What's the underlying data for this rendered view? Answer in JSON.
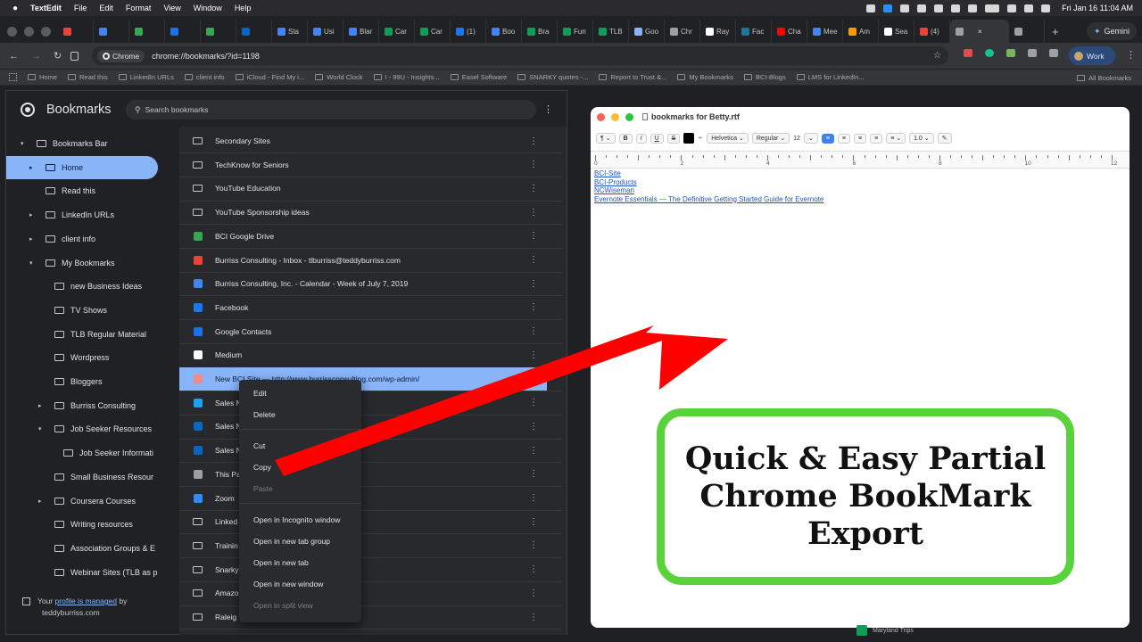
{
  "menubar": {
    "app": "TextEdit",
    "items": [
      "File",
      "Edit",
      "Format",
      "View",
      "Window",
      "Help"
    ],
    "clock": "Fri Jan 16  11:04 AM"
  },
  "tabs": [
    {
      "label": "",
      "color": "#ea4335"
    },
    {
      "label": "",
      "color": "#4285f4"
    },
    {
      "label": "",
      "color": "#34a853"
    },
    {
      "label": "",
      "color": "#1a73e8"
    },
    {
      "label": "",
      "color": "#34a853"
    },
    {
      "label": "",
      "color": "#0a66c2"
    },
    {
      "label": "Sta",
      "color": "#4285f4"
    },
    {
      "label": "Usi",
      "color": "#4285f4"
    },
    {
      "label": "Blar",
      "color": "#4285f4"
    },
    {
      "label": "Car",
      "color": "#0f9d58"
    },
    {
      "label": "Car",
      "color": "#0f9d58"
    },
    {
      "label": "(1)",
      "color": "#1877f2"
    },
    {
      "label": "Boo",
      "color": "#4285f4"
    },
    {
      "label": "Bra",
      "color": "#0f9d58"
    },
    {
      "label": "Fun",
      "color": "#0f9d58"
    },
    {
      "label": "TLB",
      "color": "#0f9d58"
    },
    {
      "label": "Goo",
      "color": "#8ab4f8"
    },
    {
      "label": "Chr",
      "color": "#9aa0a6"
    },
    {
      "label": "Ray",
      "color": "#ffffff"
    },
    {
      "label": "Fac",
      "color": "#21759b"
    },
    {
      "label": "Cha",
      "color": "#ff0000"
    },
    {
      "label": "Mee",
      "color": "#4285f4"
    },
    {
      "label": "Am",
      "color": "#ff9900"
    },
    {
      "label": "Sea",
      "color": "#ffffff"
    },
    {
      "label": "(4)",
      "color": "#ea4335"
    },
    {
      "label": "",
      "color": "#9aa0a6"
    },
    {
      "label": "",
      "color": "#9aa0a6"
    }
  ],
  "gemini_label": "Gemini",
  "omnibox": {
    "chip": "Chrome",
    "url": "chrome://bookmarks/?id=1198"
  },
  "work_label": "Work",
  "bookmarks_bar": [
    "Home",
    "Read this",
    "LinkedIn URLs",
    "client info",
    "iCloud - Find My i...",
    "World Clock",
    "! - 99U - Insights...",
    "Easel Software",
    "SNARKY quotes -...",
    "Report to Trust &...",
    "My Bookmarks",
    "BCI-Blogs",
    "LMS for LinkedIn..."
  ],
  "all_bookmarks": "All Bookmarks",
  "bm": {
    "title": "Bookmarks",
    "search_placeholder": "Search bookmarks",
    "tree": [
      {
        "label": "Bookmarks Bar",
        "depth": 0,
        "caret": "open"
      },
      {
        "label": "Home",
        "depth": 1,
        "caret": "closed",
        "selected": true
      },
      {
        "label": "Read this",
        "depth": 1,
        "caret": ""
      },
      {
        "label": "LinkedIn URLs",
        "depth": 1,
        "caret": "closed"
      },
      {
        "label": "client info",
        "depth": 1,
        "caret": "closed"
      },
      {
        "label": "My Bookmarks",
        "depth": 1,
        "caret": "open"
      },
      {
        "label": "new Business Ideas",
        "depth": 2,
        "caret": ""
      },
      {
        "label": "TV Shows",
        "depth": 2,
        "caret": ""
      },
      {
        "label": "TLB Regular Material",
        "depth": 2,
        "caret": ""
      },
      {
        "label": "Wordpress",
        "depth": 2,
        "caret": ""
      },
      {
        "label": "Bloggers",
        "depth": 2,
        "caret": ""
      },
      {
        "label": "Burriss Consulting",
        "depth": 2,
        "caret": "closed"
      },
      {
        "label": "Job Seeker Resources",
        "depth": 2,
        "caret": "open"
      },
      {
        "label": "Job Seeker Informati",
        "depth": 3,
        "caret": ""
      },
      {
        "label": "Small Business Resour",
        "depth": 2,
        "caret": ""
      },
      {
        "label": "Coursera Courses",
        "depth": 2,
        "caret": "closed"
      },
      {
        "label": "Writing resources",
        "depth": 2,
        "caret": ""
      },
      {
        "label": "Association Groups & E",
        "depth": 2,
        "caret": ""
      },
      {
        "label": "Webinar Sites (TLB as p",
        "depth": 2,
        "caret": ""
      }
    ],
    "managed_prefix": "Your ",
    "managed_link": "profile is managed",
    "managed_suffix": " by",
    "managed_domain": "teddyburriss.com",
    "list": [
      {
        "label": "Secondary Sites",
        "kind": "folder"
      },
      {
        "label": "TechKnow for Seniors",
        "kind": "folder"
      },
      {
        "label": "YouTube Education",
        "kind": "folder"
      },
      {
        "label": "YouTube Sponsorship ideas",
        "kind": "folder"
      },
      {
        "label": "BCI Google Drive",
        "kind": "site",
        "color": "#34a853"
      },
      {
        "label": "Burriss Consulting - Inbox - tlburriss@teddyburriss.com",
        "kind": "site",
        "color": "#ea4335"
      },
      {
        "label": "Burriss Consulting, Inc. - Calendar - Week of July 7, 2019",
        "kind": "site",
        "color": "#4285f4"
      },
      {
        "label": "Facebook",
        "kind": "site",
        "color": "#1877f2"
      },
      {
        "label": "Google Contacts",
        "kind": "site",
        "color": "#1a73e8"
      },
      {
        "label": "Medium",
        "kind": "site",
        "color": "#ffffff"
      },
      {
        "label": "New BCI Site — http://www.burrissconsulting.com/wp-admin/",
        "kind": "site",
        "color": "#f28b82",
        "selected": true
      },
      {
        "label": "Sales N",
        "kind": "site",
        "color": "#1da1f2"
      },
      {
        "label": "Sales N",
        "kind": "site",
        "color": "#0a66c2"
      },
      {
        "label": "Sales N",
        "kind": "site",
        "color": "#0a66c2"
      },
      {
        "label": "This Pa",
        "kind": "site",
        "color": "#9aa0a6"
      },
      {
        "label": "Zoom",
        "kind": "site",
        "color": "#2d8cff"
      },
      {
        "label": "Linked",
        "kind": "folder"
      },
      {
        "label": "Trainin",
        "kind": "folder"
      },
      {
        "label": "Snarky",
        "kind": "folder"
      },
      {
        "label": "Amazo",
        "kind": "folder"
      },
      {
        "label": "Raleig",
        "kind": "folder"
      }
    ],
    "context_menu": [
      {
        "label": "Edit",
        "disabled": false,
        "sep_after": false
      },
      {
        "label": "Delete",
        "disabled": false,
        "sep_after": true
      },
      {
        "label": "Cut",
        "disabled": false,
        "sep_after": false
      },
      {
        "label": "Copy",
        "disabled": false,
        "sep_after": false
      },
      {
        "label": "Paste",
        "disabled": true,
        "sep_after": true
      },
      {
        "label": "Open in Incognito window",
        "disabled": false,
        "sep_after": false
      },
      {
        "label": "Open in new tab group",
        "disabled": false,
        "sep_after": false
      },
      {
        "label": "Open in new tab",
        "disabled": false,
        "sep_after": false
      },
      {
        "label": "Open in new window",
        "disabled": false,
        "sep_after": false
      },
      {
        "label": "Open in split view",
        "disabled": true,
        "sep_after": false
      }
    ]
  },
  "rtf": {
    "title": "bookmarks for Betty.rtf",
    "toolbar": {
      "paragraph": "¶",
      "bold": "B",
      "italic": "I",
      "underline": "U",
      "strike": "S",
      "font": "Helvetica",
      "style": "Regular",
      "size": "12",
      "spacing": "1.0"
    },
    "ruler": [
      "0",
      "2",
      "4",
      "6",
      "8",
      "10",
      "12"
    ],
    "links": [
      "BCI-Site",
      "BCI-Products",
      "NCWiseman",
      "Evernote Essentials — The Definitive Getting Started Guide for Evernote"
    ]
  },
  "callout": {
    "text": "Quick & Easy Partial\nChrome BookMark\nExport",
    "border_color": "#5ad23c"
  },
  "arrow_color": "#ff0000",
  "dock_peek": "Maryland Trips"
}
